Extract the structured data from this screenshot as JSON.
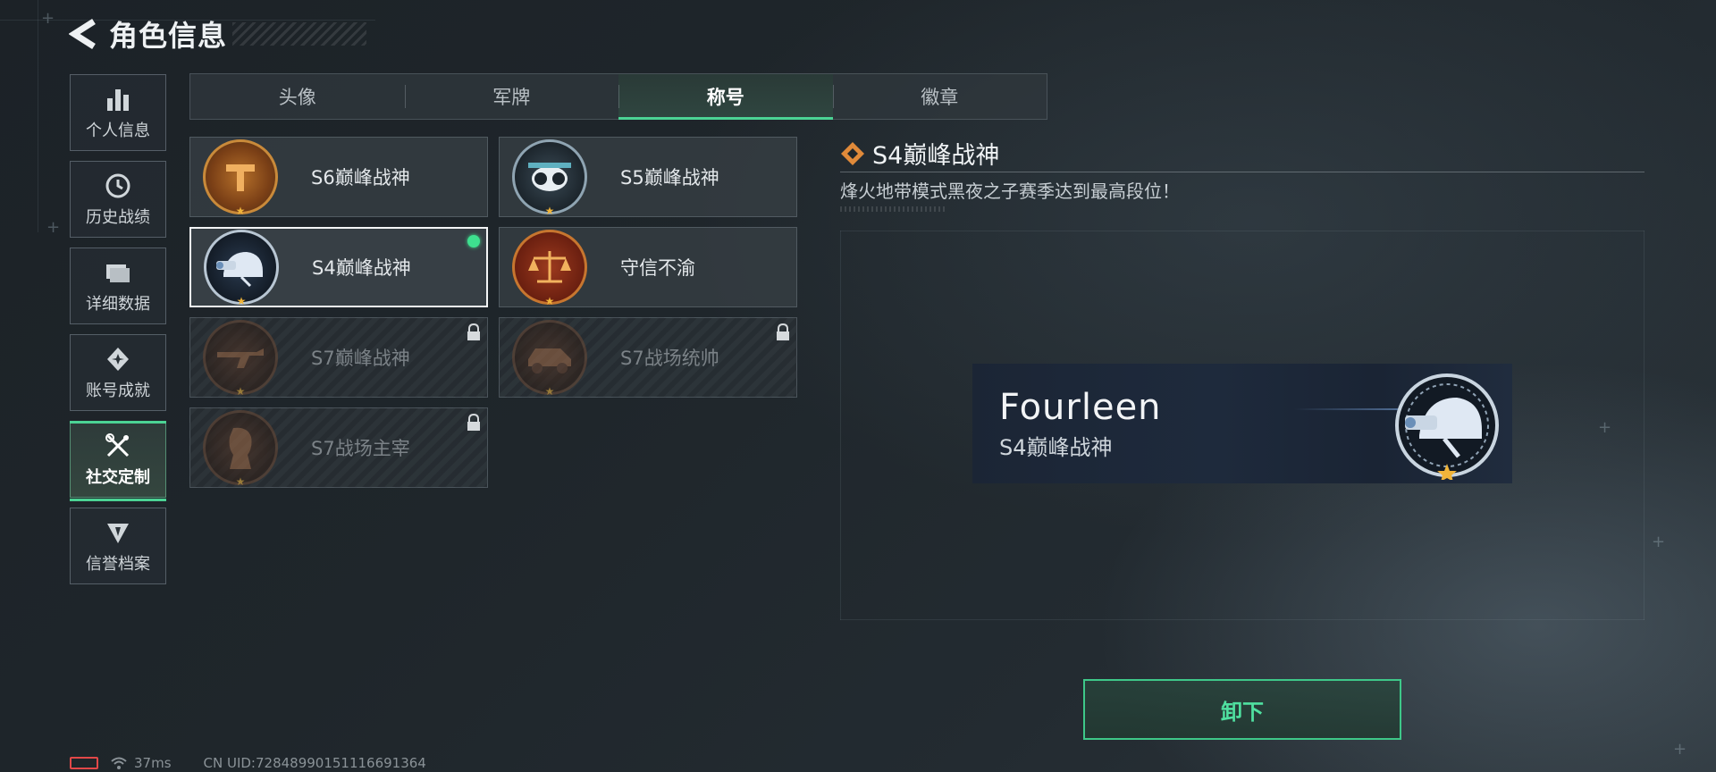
{
  "header": {
    "title": "角色信息",
    "back_icon": "back-arrow-icon"
  },
  "sidebar": {
    "items": [
      {
        "label": "个人信息",
        "icon": "bar-chart-icon",
        "active": false
      },
      {
        "label": "历史战绩",
        "icon": "history-clock-icon",
        "active": false
      },
      {
        "label": "详细数据",
        "icon": "folder-icon",
        "active": false
      },
      {
        "label": "账号成就",
        "icon": "achievement-icon",
        "active": false
      },
      {
        "label": "社交定制",
        "icon": "tools-icon",
        "active": true
      },
      {
        "label": "信誉档案",
        "icon": "credit-badge-icon",
        "active": false
      }
    ]
  },
  "tabs": [
    {
      "label": "头像",
      "active": false
    },
    {
      "label": "军牌",
      "active": false
    },
    {
      "label": "称号",
      "active": true
    },
    {
      "label": "徽章",
      "active": false
    }
  ],
  "titles": [
    {
      "name": "S6巅峰战神",
      "emblem": "s6-emblem-icon",
      "locked": false,
      "selected": false,
      "equipped": false
    },
    {
      "name": "S5巅峰战神",
      "emblem": "s5-emblem-icon",
      "locked": false,
      "selected": false,
      "equipped": false
    },
    {
      "name": "S4巅峰战神",
      "emblem": "s4-emblem-icon",
      "locked": false,
      "selected": true,
      "equipped": true
    },
    {
      "name": "守信不渝",
      "emblem": "scales-emblem-icon",
      "locked": false,
      "selected": false,
      "equipped": false
    },
    {
      "name": "S7巅峰战神",
      "emblem": "s7-gun-emblem-icon",
      "locked": true,
      "selected": false,
      "equipped": false
    },
    {
      "name": "S7战场统帅",
      "emblem": "s7-vehicle-emblem-icon",
      "locked": true,
      "selected": false,
      "equipped": false
    },
    {
      "name": "S7战场主宰",
      "emblem": "s7-soldier-emblem-icon",
      "locked": true,
      "selected": false,
      "equipped": false
    }
  ],
  "detail": {
    "title": "S4巅峰战神",
    "description": "烽火地带模式黑夜之子赛季达到最高段位！"
  },
  "nameplate": {
    "player_name": "Fourleen",
    "title": "S4巅峰战神"
  },
  "actions": {
    "unequip_label": "卸下"
  },
  "status_bar": {
    "ping": "37ms",
    "uid": "CN UID:7284899015111669136​4"
  },
  "colors": {
    "accent_green": "#4bd394",
    "equipped_dot": "#3ee08f",
    "lock_red_battery": "#e24848"
  }
}
